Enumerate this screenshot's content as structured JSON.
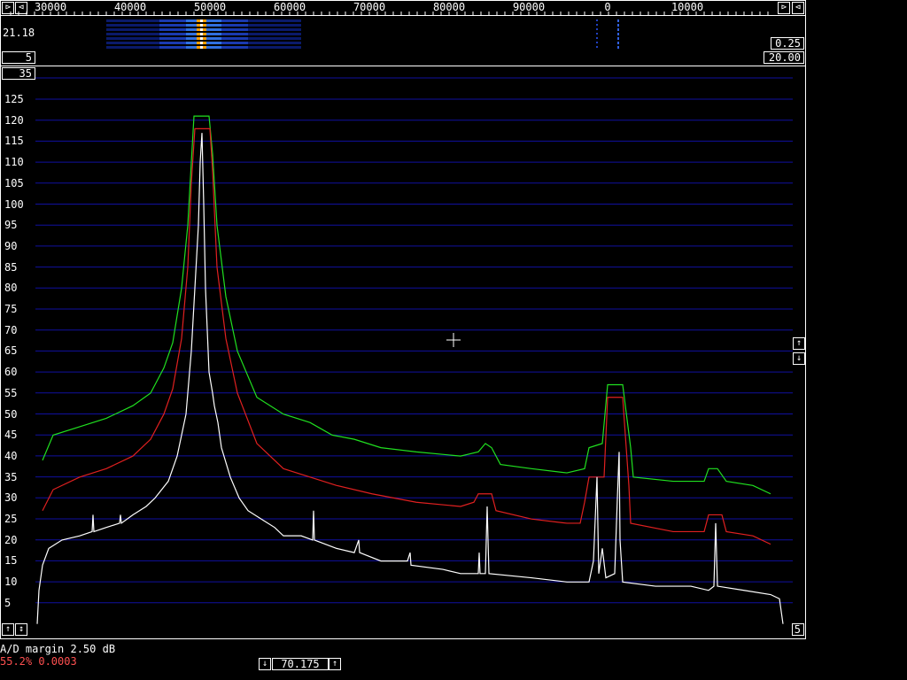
{
  "top_bar": {
    "frequency_labels": [
      "30000",
      "40000",
      "50000",
      "60000",
      "70000",
      "80000",
      "90000",
      "0",
      "10000"
    ],
    "left_buttons": [
      "⊳",
      "⊲"
    ],
    "right_buttons": [
      "⊳",
      "⊲"
    ]
  },
  "waterfall_panel": {
    "level_value": "21.18",
    "avg_box": "5",
    "gain_box": "0.25",
    "span_box": "20.00"
  },
  "spectrum": {
    "top_box": "35",
    "y_ticks": [
      "125",
      "120",
      "115",
      "110",
      "105",
      "100",
      "95",
      "90",
      "85",
      "80",
      "75",
      "70",
      "65",
      "60",
      "55",
      "50",
      "45",
      "40",
      "35",
      "30",
      "25",
      "20",
      "15",
      "10",
      "5"
    ],
    "right_scroll_up": "↑",
    "right_scroll_down": "↓",
    "bottom_left_buttons": [
      "↑",
      "↕"
    ],
    "bottom_right_box": "5",
    "colors": {
      "grid": "#1010a0",
      "green": "#20e020",
      "red": "#e02020",
      "white": "#ffffff"
    }
  },
  "status": {
    "ad_margin": "A/D margin 2.50 dB",
    "cpu_line": "55.2% 0.0003",
    "freq_down_btn": "↓",
    "freq_value": "70.175",
    "freq_up_btn": "↑"
  }
}
